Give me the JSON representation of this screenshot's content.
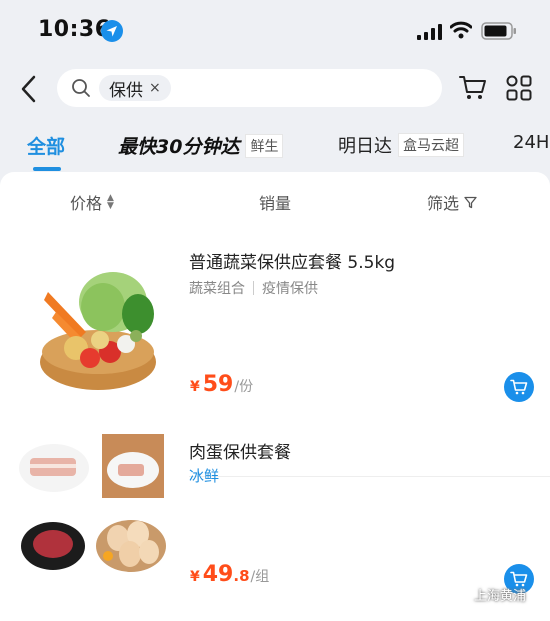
{
  "status_bar": {
    "time": "10:36",
    "icons": [
      "location-arrow-icon",
      "signal-icon",
      "wifi-icon",
      "battery-icon"
    ]
  },
  "search": {
    "tag": "保供",
    "tag_close": "×"
  },
  "tabs": [
    {
      "label": "全部",
      "active": true
    },
    {
      "label": "最快30分钟达",
      "badge": "鲜生"
    },
    {
      "label": "明日达",
      "badge": "盒马云超"
    },
    {
      "label": "24H"
    }
  ],
  "filters": {
    "price": "价格",
    "sales": "销量",
    "screen": "筛选"
  },
  "products": [
    {
      "title": "普通蔬菜保供应套餐 5.5kg",
      "tags": [
        "蔬菜组合",
        "疫情保供"
      ],
      "price_symbol": "¥",
      "price_int": "59",
      "price_dec": "",
      "price_unit": "/份"
    },
    {
      "title": "肉蛋保供套餐",
      "label": "冰鲜",
      "price_symbol": "¥",
      "price_int": "49",
      "price_dec": ".8",
      "price_unit": "/组"
    }
  ],
  "watermark": "上海黄浦",
  "colors": {
    "accent": "#1f8fe0",
    "price": "#ff4d1a",
    "background": "#eef0f4"
  }
}
